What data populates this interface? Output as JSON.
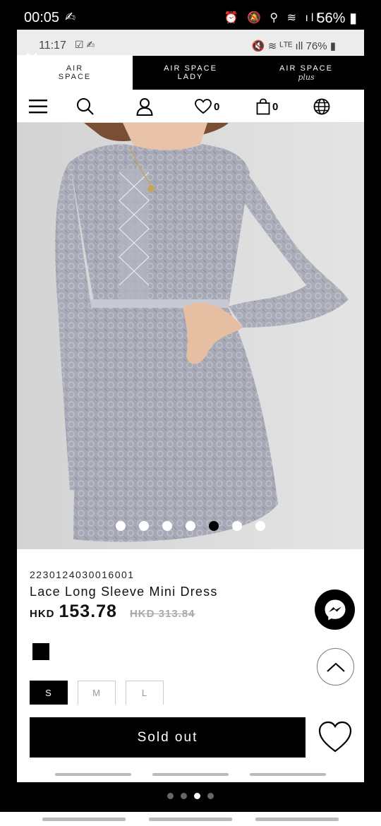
{
  "outer_status": {
    "time": "00:05",
    "battery": "56%"
  },
  "inner_status": {
    "time": "11:17",
    "battery": "76%"
  },
  "brand_tabs": [
    {
      "line1": "AIR",
      "line2": "SPACE"
    },
    {
      "line1": "AIR SPACE",
      "line2": "LADY"
    },
    {
      "line1": "AIR SPACE",
      "line2": "plus"
    }
  ],
  "toolbar": {
    "wishlist_count": "0",
    "cart_count": "0"
  },
  "carousel": {
    "total_images": 7,
    "active_index": 4
  },
  "product": {
    "sku": "2230124030016001",
    "name": "Lace Long Sleeve Mini Dress",
    "currency": "HKD",
    "price": "153.78",
    "original_price": "HKD 313.84",
    "color_swatch": "#000000",
    "sizes": [
      "S",
      "M",
      "L"
    ],
    "selected_size": "S",
    "cta_label": "Sold out"
  },
  "colors": {
    "dress": "#a7a9b6",
    "background": "#dcdcdc",
    "accent": "#000000"
  },
  "pager": {
    "total": 4,
    "active_index": 2
  }
}
